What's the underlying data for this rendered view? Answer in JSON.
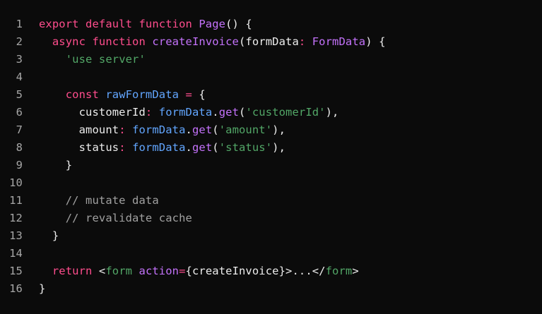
{
  "code_block": {
    "lines": [
      {
        "n": "1",
        "tokens": [
          {
            "t": "export default function ",
            "c": "keyword"
          },
          {
            "t": "Page",
            "c": "fn"
          },
          {
            "t": "() {",
            "c": "plain"
          }
        ]
      },
      {
        "n": "2",
        "tokens": [
          {
            "t": "  ",
            "c": "plain"
          },
          {
            "t": "async function ",
            "c": "keyword"
          },
          {
            "t": "createInvoice",
            "c": "fn"
          },
          {
            "t": "(formData",
            "c": "plain"
          },
          {
            "t": ": ",
            "c": "op"
          },
          {
            "t": "FormData",
            "c": "fn"
          },
          {
            "t": ") {",
            "c": "plain"
          }
        ]
      },
      {
        "n": "3",
        "tokens": [
          {
            "t": "    ",
            "c": "plain"
          },
          {
            "t": "'use server'",
            "c": "string"
          }
        ]
      },
      {
        "n": "4",
        "tokens": []
      },
      {
        "n": "5",
        "tokens": [
          {
            "t": "    ",
            "c": "plain"
          },
          {
            "t": "const ",
            "c": "keyword"
          },
          {
            "t": "rawFormData",
            "c": "var"
          },
          {
            "t": " = ",
            "c": "op"
          },
          {
            "t": "{",
            "c": "plain"
          }
        ]
      },
      {
        "n": "6",
        "tokens": [
          {
            "t": "      customerId",
            "c": "plain"
          },
          {
            "t": ": ",
            "c": "op"
          },
          {
            "t": "formData",
            "c": "var"
          },
          {
            "t": ".",
            "c": "plain"
          },
          {
            "t": "get",
            "c": "fn"
          },
          {
            "t": "(",
            "c": "plain"
          },
          {
            "t": "'customerId'",
            "c": "string"
          },
          {
            "t": "),",
            "c": "plain"
          }
        ]
      },
      {
        "n": "7",
        "tokens": [
          {
            "t": "      amount",
            "c": "plain"
          },
          {
            "t": ": ",
            "c": "op"
          },
          {
            "t": "formData",
            "c": "var"
          },
          {
            "t": ".",
            "c": "plain"
          },
          {
            "t": "get",
            "c": "fn"
          },
          {
            "t": "(",
            "c": "plain"
          },
          {
            "t": "'amount'",
            "c": "string"
          },
          {
            "t": "),",
            "c": "plain"
          }
        ]
      },
      {
        "n": "8",
        "tokens": [
          {
            "t": "      status",
            "c": "plain"
          },
          {
            "t": ": ",
            "c": "op"
          },
          {
            "t": "formData",
            "c": "var"
          },
          {
            "t": ".",
            "c": "plain"
          },
          {
            "t": "get",
            "c": "fn"
          },
          {
            "t": "(",
            "c": "plain"
          },
          {
            "t": "'status'",
            "c": "string"
          },
          {
            "t": "),",
            "c": "plain"
          }
        ]
      },
      {
        "n": "9",
        "tokens": [
          {
            "t": "    }",
            "c": "plain"
          }
        ]
      },
      {
        "n": "10",
        "tokens": []
      },
      {
        "n": "11",
        "tokens": [
          {
            "t": "    // mutate data",
            "c": "comment"
          }
        ]
      },
      {
        "n": "12",
        "tokens": [
          {
            "t": "    // revalidate cache",
            "c": "comment"
          }
        ]
      },
      {
        "n": "13",
        "tokens": [
          {
            "t": "  }",
            "c": "plain"
          }
        ]
      },
      {
        "n": "14",
        "tokens": []
      },
      {
        "n": "15",
        "tokens": [
          {
            "t": "  ",
            "c": "plain"
          },
          {
            "t": "return ",
            "c": "keyword"
          },
          {
            "t": "<",
            "c": "plain"
          },
          {
            "t": "form",
            "c": "tag"
          },
          {
            "t": " ",
            "c": "plain"
          },
          {
            "t": "action",
            "c": "attr"
          },
          {
            "t": "=",
            "c": "op"
          },
          {
            "t": "{createInvoice}>...</",
            "c": "plain"
          },
          {
            "t": "form",
            "c": "tag"
          },
          {
            "t": ">",
            "c": "plain"
          }
        ]
      },
      {
        "n": "16",
        "tokens": [
          {
            "t": "}",
            "c": "plain"
          }
        ]
      }
    ]
  },
  "colors": {
    "background": "#0b0b0b",
    "keyword": "#ff4d8d",
    "function": "#c472fb",
    "string": "#52a767",
    "variable": "#62a6ff",
    "comment": "#a1a1a1",
    "line_number": "#a6a6a6"
  }
}
